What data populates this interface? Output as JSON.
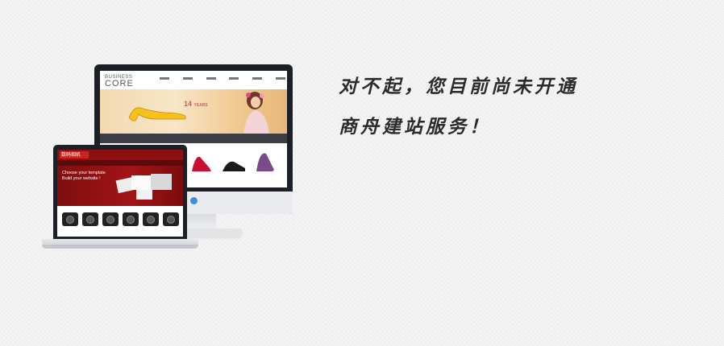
{
  "message": {
    "line1": "对不起，您目前尚未开通",
    "line2": "商舟建站服务！"
  },
  "monitor_site": {
    "logo_line1": "BUSINESS",
    "logo_line2": "CORE",
    "banner_badge": "14",
    "banner_badge_sub": "YEARS"
  },
  "laptop_site": {
    "logo": "数码相机",
    "banner_line1": "Choose your template",
    "banner_line2": "Build your website !"
  },
  "colors": {
    "accent_blue": "#3d8fd6",
    "laptop_red": "#8b1113",
    "text_dark": "#2b2b2b"
  }
}
